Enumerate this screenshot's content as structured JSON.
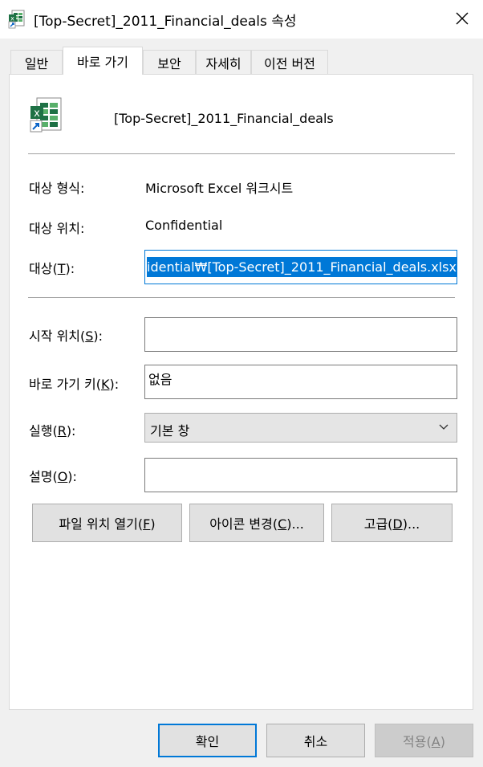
{
  "window": {
    "title": "[Top-Secret]_2011_Financial_deals 속성",
    "close_glyph": "✕"
  },
  "tabs": [
    {
      "label": "일반"
    },
    {
      "label": "바로 가기"
    },
    {
      "label": "보안"
    },
    {
      "label": "자세히"
    },
    {
      "label": "이전 버전"
    }
  ],
  "shortcut": {
    "file_name": "[Top-Secret]_2011_Financial_deals",
    "target_type_label": "대상 형식:",
    "target_type_value": "Microsoft Excel 워크시트",
    "target_location_label": "대상 위치:",
    "target_location_value": "Confidential",
    "target_label_prefix": "대상(",
    "target_label_key": "T",
    "target_label_suffix": "):",
    "target_value": "idential₩[Top-Secret]_2011_Financial_deals.xlsx",
    "start_in_label_prefix": "시작 위치(",
    "start_in_label_key": "S",
    "start_in_label_suffix": "):",
    "start_in_value": "",
    "hotkey_label_prefix": "바로 가기 키(",
    "hotkey_label_key": "K",
    "hotkey_label_suffix": "):",
    "hotkey_value": "없음",
    "run_label_prefix": "실행(",
    "run_label_key": "R",
    "run_label_suffix": "):",
    "run_value": "기본 창",
    "comment_label_prefix": "설명(",
    "comment_label_key": "O",
    "comment_label_suffix": "):",
    "comment_value": ""
  },
  "actions": {
    "open_location_prefix": "파일 위치 열기(",
    "open_location_key": "F",
    "open_location_suffix": ")",
    "change_icon_prefix": "아이콘 변경(",
    "change_icon_key": "C",
    "change_icon_suffix": ")...",
    "advanced_prefix": "고급(",
    "advanced_key": "D",
    "advanced_suffix": ")..."
  },
  "footer": {
    "ok": "확인",
    "cancel": "취소",
    "apply_prefix": "적용(",
    "apply_key": "A",
    "apply_suffix": ")"
  },
  "colors": {
    "accent": "#0078d7",
    "excel_green": "#1e7145"
  }
}
